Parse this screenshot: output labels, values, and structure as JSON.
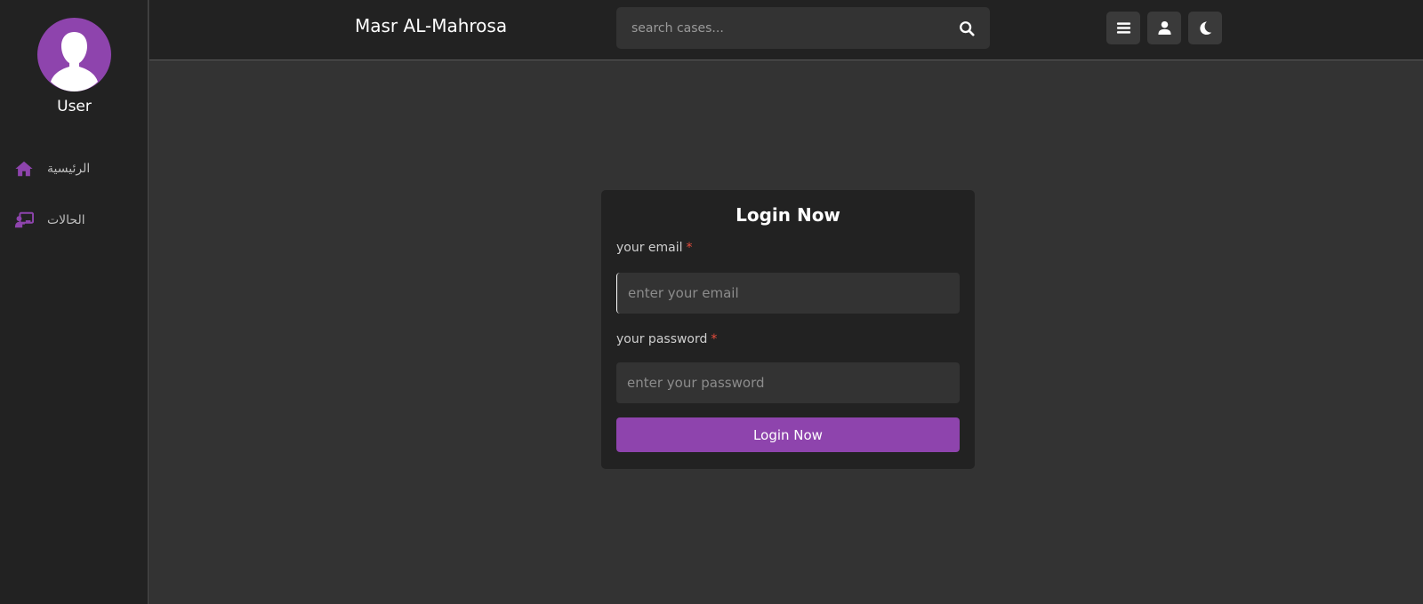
{
  "sidebar": {
    "user_name": "User",
    "items": [
      {
        "label": "الرئيسية",
        "icon": "home-icon"
      },
      {
        "label": "الحالات",
        "icon": "chalkboard-teacher-icon"
      }
    ]
  },
  "header": {
    "brand": "Masr AL-Mahrosa",
    "search_placeholder": "search cases...",
    "buttons": [
      "menu-icon",
      "user-icon",
      "moon-icon"
    ]
  },
  "login": {
    "title": "Login Now",
    "email_label": "your email",
    "email_placeholder": "enter your email",
    "password_label": "your password",
    "password_placeholder": "enter your password",
    "required_mark": "*",
    "submit_label": "Login Now"
  },
  "colors": {
    "accent": "#8e44ad",
    "required": "#e74c3c",
    "sidebar_bg": "#222222",
    "page_bg": "#333333"
  }
}
